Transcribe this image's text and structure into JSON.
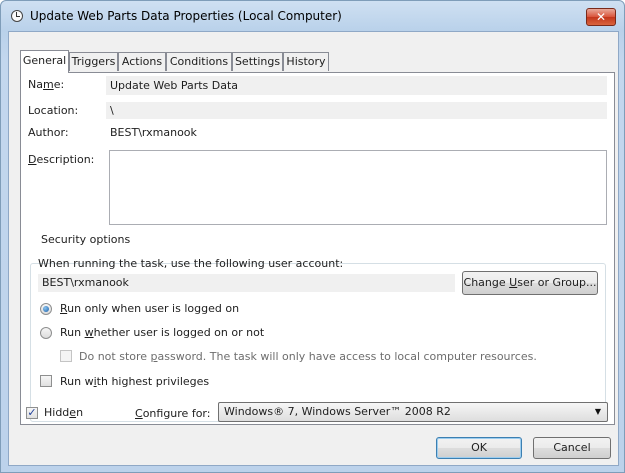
{
  "window": {
    "title": "Update Web Parts Data Properties (Local Computer)",
    "close_glyph": "✕"
  },
  "tabs": [
    {
      "label": "General",
      "active": true
    },
    {
      "label": "Triggers"
    },
    {
      "label": "Actions"
    },
    {
      "label": "Conditions"
    },
    {
      "label": "Settings"
    },
    {
      "label": "History"
    }
  ],
  "general": {
    "name_label_pre": "Na",
    "name_label_u": "m",
    "name_label_post": "e:",
    "name_value": "Update Web Parts Data",
    "location_label": "Location:",
    "location_value": "\\",
    "author_label": "Author:",
    "author_value": "BEST\\rxmanook",
    "description_label_u": "D",
    "description_label_post": "escription:",
    "description_value": ""
  },
  "security": {
    "group_title": "Security options",
    "account_prompt": "When running the task, use the following user account:",
    "account_value": "BEST\\rxmanook",
    "change_btn_pre": "Change ",
    "change_btn_u": "U",
    "change_btn_post": "ser or Group...",
    "radio1_u": "R",
    "radio1_post": "un only when user is logged on",
    "radio2_pre": "Run ",
    "radio2_u": "w",
    "radio2_post": "hether user is logged on or not",
    "no_store_pre": "Do not store ",
    "no_store_u": "p",
    "no_store_post": "assword.  The task will only have access to local computer resources.",
    "highest_pre": "Run w",
    "highest_u": "i",
    "highest_post": "th highest privileges"
  },
  "footer": {
    "hidden_pre": "Hidd",
    "hidden_u": "e",
    "hidden_post": "n",
    "hidden_checked": true,
    "check_glyph": "✓",
    "configure_u": "C",
    "configure_post": "onfigure for:",
    "configure_value": "Windows® 7, Windows Server™ 2008 R2",
    "dropdown_glyph": "▼",
    "ok_label": "OK",
    "cancel_label": "Cancel"
  },
  "colors": {
    "title_gradient": "#c3d7ee",
    "close_red": "#d9533a",
    "focus_blue": "#3c7fb1"
  },
  "icons": {
    "title": "task-clock-icon",
    "close": "close-icon",
    "dropdown": "chevron-down-icon"
  }
}
